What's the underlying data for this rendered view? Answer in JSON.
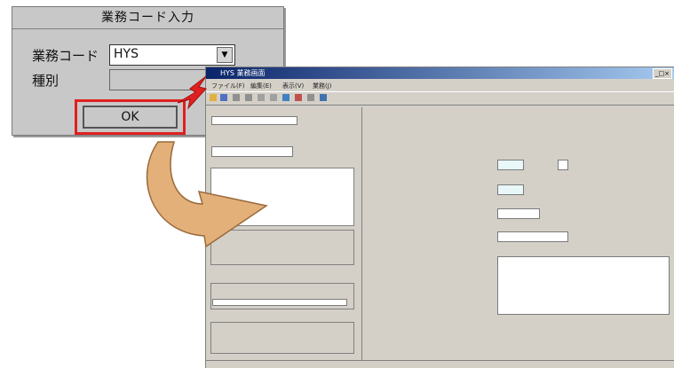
{
  "dialog": {
    "title": "業務コード入力",
    "business_code_label": "業務コード",
    "business_code_value": "HYS",
    "kind_label": "種別",
    "ok_label": "OK"
  },
  "window": {
    "title": "HYS 業務画面",
    "menu": [
      "ファイル(F)",
      "編集(E)",
      "表示(V)",
      "業務(J)"
    ]
  },
  "colors": {
    "highlight": "#e02020",
    "arrow": "#d9a46a",
    "title_active": "#0a246a"
  }
}
